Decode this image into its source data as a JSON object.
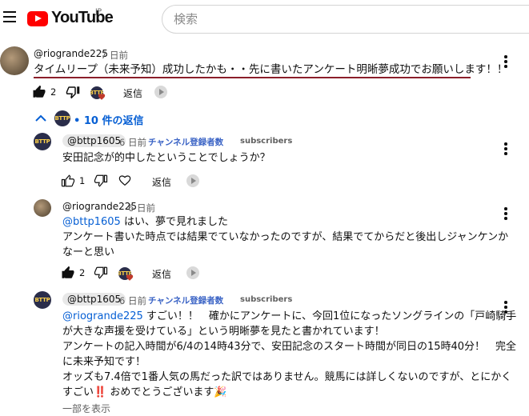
{
  "header": {
    "logo_text": "YouTube",
    "region": "JP",
    "search_placeholder": "検索"
  },
  "comment": {
    "author": "@riogrande225",
    "time": "7 日前",
    "text": "タイムリープ（未来予知）成功したかも・・先に書いたアンケート明晰夢成功でお願いします！！",
    "likes": "2",
    "reply_label": "返信"
  },
  "replies_toggle": "10 件の返信",
  "replies": [
    {
      "author": "@bttp1605",
      "time": "6 日前",
      "badge": "チャンネル登録者数",
      "badge_suffix": "subscribers",
      "text": "安田記念が的中したということでしょうか？",
      "likes": "1",
      "reply_label": "返信"
    },
    {
      "author": "@riogrande225",
      "time": "6 日前",
      "mention": "@bttp1605",
      "line1": "はい、夢で見れました",
      "line2": "アンケート書いた時点では結果でていなかったのですが、結果でてからだと後出しジャンケンか",
      "line3": "なーと思い",
      "likes": "2",
      "reply_label": "返信"
    },
    {
      "author": "@bttp1605",
      "time": "6 日前",
      "badge": "チャンネル登録者数",
      "badge_suffix": "subscribers",
      "mention": "@riogrande225",
      "line1": "すごい！！　確かにアンケートに、今回1位になったソングラインの「戸崎騎手",
      "line2": "が大きな声援を受けている」という明晰夢を見たと書かれています！",
      "line3": "アンケートの記入時間が6/4の14時43分で、安田記念のスタート時間が同日の15時40分！　完全",
      "line4": "に未来予知です！",
      "line5": "オッズも7.4倍で1番人気の馬だった訳ではありません。競馬には詳しくないのですが、とにかく",
      "line6": "すごい",
      "line6_emoji1": "‼️",
      "line6_rest": "おめでとうございます",
      "line6_emoji2": "🎉",
      "show_more": "一部を表示"
    }
  ],
  "avatar_text": "BTTP",
  "colors": {
    "brand_red": "#ff0000",
    "link_blue": "#065fd4",
    "underline": "#8b1e2a"
  }
}
